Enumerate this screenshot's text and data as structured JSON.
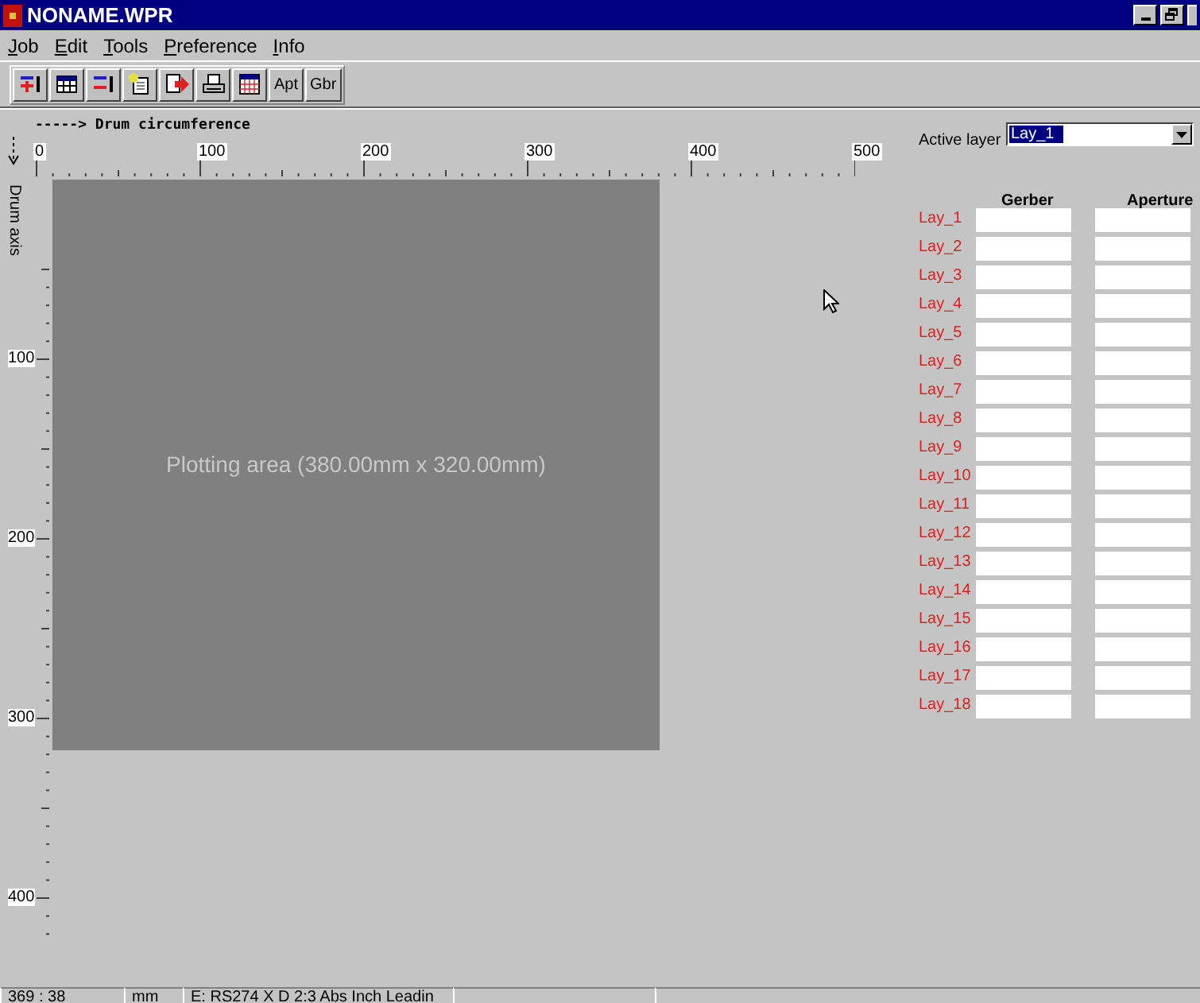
{
  "window": {
    "title": "NONAME.WPR"
  },
  "menu": [
    "Job",
    "Edit",
    "Tools",
    "Preference",
    "Info"
  ],
  "toolbar": [
    {
      "kind": "icon"
    },
    {
      "kind": "icon"
    },
    {
      "kind": "icon"
    },
    {
      "kind": "icon"
    },
    {
      "kind": "icon"
    },
    {
      "kind": "icon"
    },
    {
      "kind": "icon"
    },
    {
      "kind": "text",
      "label": "Apt"
    },
    {
      "kind": "text",
      "label": "Gbr"
    }
  ],
  "canvas": {
    "x_axis_label": "-----> Drum circumference",
    "y_axis_label": "Drum axis",
    "x_ticks": [
      "0",
      "100",
      "200",
      "300",
      "400",
      "500"
    ],
    "y_ticks": [
      "100",
      "200",
      "300",
      "400"
    ],
    "plot_area_label": "Plotting area (380.00mm x 320.00mm)"
  },
  "layer_panel": {
    "active_layer_label": "Active layer",
    "active_layer_value": "Lay_1",
    "columns": [
      "Gerber",
      "Aperture"
    ],
    "layers": [
      "Lay_1",
      "Lay_2",
      "Lay_3",
      "Lay_4",
      "Lay_5",
      "Lay_6",
      "Lay_7",
      "Lay_8",
      "Lay_9",
      "Lay_10",
      "Lay_11",
      "Lay_12",
      "Lay_13",
      "Lay_14",
      "Lay_15",
      "Lay_16",
      "Lay_17",
      "Lay_18"
    ]
  },
  "status_bar": [
    "369 : 38",
    "mm",
    "E: RS274 X D 2:3 Abs Inch Leadin"
  ]
}
